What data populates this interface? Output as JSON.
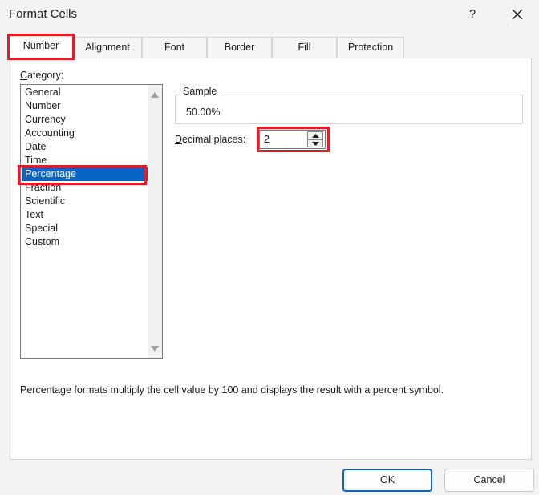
{
  "window": {
    "title": "Format Cells",
    "help_label": "?"
  },
  "tabs": [
    {
      "label": "Number",
      "active": true
    },
    {
      "label": "Alignment",
      "active": false
    },
    {
      "label": "Font",
      "active": false
    },
    {
      "label": "Border",
      "active": false
    },
    {
      "label": "Fill",
      "active": false
    },
    {
      "label": "Protection",
      "active": false
    }
  ],
  "category": {
    "label_mnemonic": "C",
    "label_rest": "ategory:",
    "items": [
      "General",
      "Number",
      "Currency",
      "Accounting",
      "Date",
      "Time",
      "Percentage",
      "Fraction",
      "Scientific",
      "Text",
      "Special",
      "Custom"
    ],
    "selected": "Percentage"
  },
  "sample": {
    "label": "Sample",
    "value": "50.00%"
  },
  "decimal_places": {
    "label_mnemonic": "D",
    "label_rest": "ecimal places:",
    "value": "2"
  },
  "description": "Percentage formats multiply the cell value by 100 and displays the result with a percent symbol.",
  "buttons": {
    "ok": "OK",
    "cancel": "Cancel"
  },
  "colors": {
    "highlight": "#e21d2a",
    "selection": "#0a64c8"
  }
}
